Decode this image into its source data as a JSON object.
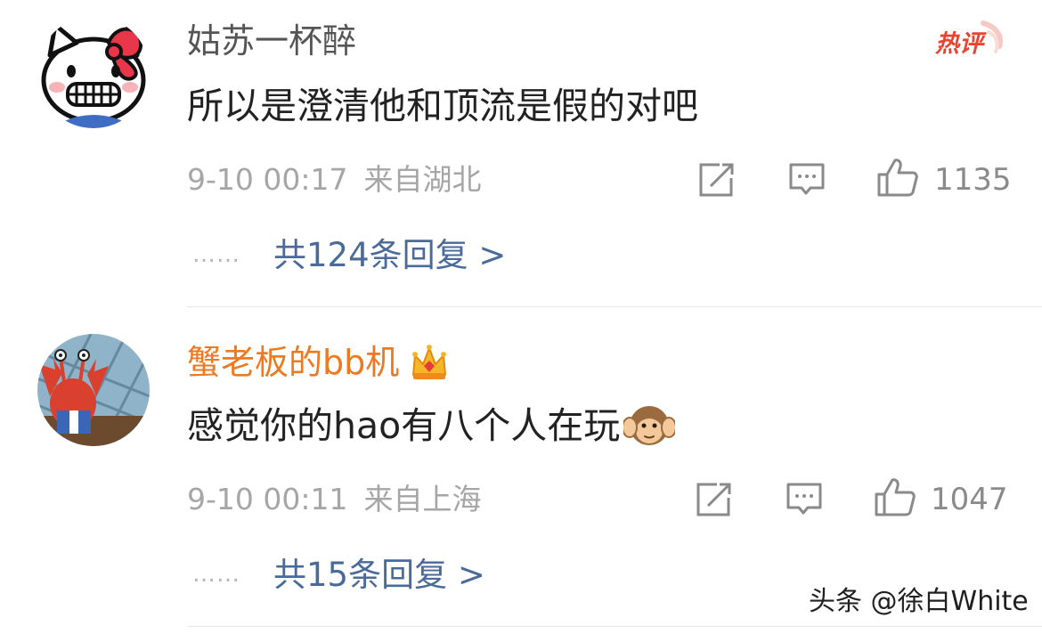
{
  "comments": [
    {
      "username": "姑苏一杯醉",
      "content": "所以是澄清他和顶流是假的对吧",
      "time": "9-10 00:17",
      "location": "来自湖北",
      "likes": "1135",
      "dots": "……",
      "replies_label": "共124条回复 >",
      "badge": "热评",
      "username_color": "#555555",
      "avatar_icon": "hello-kitty-avatar"
    },
    {
      "username": "蟹老板的bb机",
      "content": "感觉你的hao有八个人在玩",
      "time": "9-10 00:11",
      "location": "来自上海",
      "likes": "1047",
      "dots": "……",
      "replies_label": "共15条回复 >",
      "username_color": "#ec7a22",
      "avatar_icon": "mr-krabs-avatar",
      "username_badge_icon": "crown-icon",
      "content_emoji_icon": "hear-no-evil-monkey-icon"
    }
  ],
  "action_icons": [
    "repost-icon",
    "comment-icon",
    "like-icon"
  ],
  "watermark": "头条 @徐白White",
  "colors": {
    "reply_link": "#4a6a9a",
    "meta_gray": "#a6a6a6",
    "hot_badge": "#e8442f"
  }
}
